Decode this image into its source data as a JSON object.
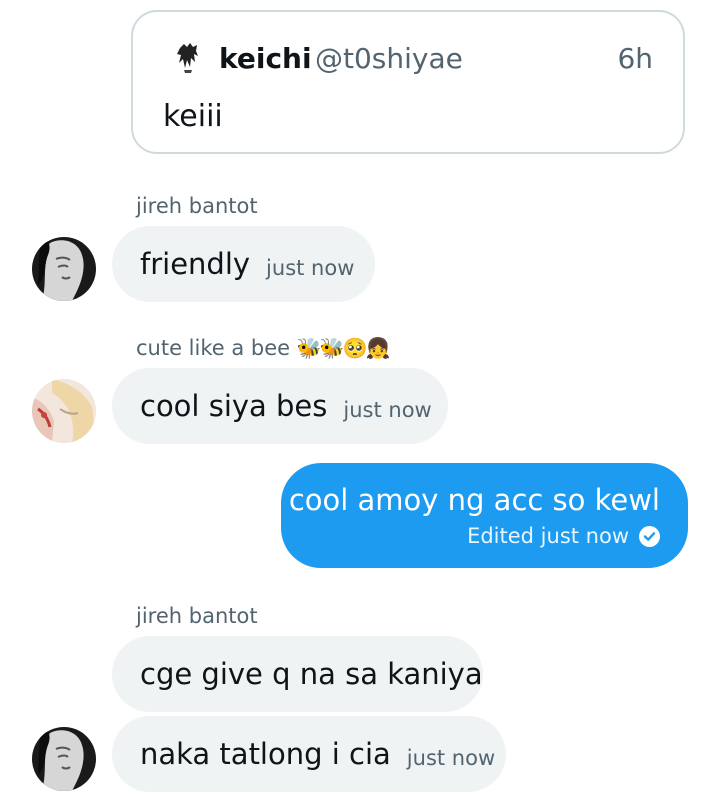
{
  "quote": {
    "name": "keichi",
    "handle": "@t0shiyae",
    "time": "6h",
    "text": "keiii"
  },
  "messages": [
    {
      "sender": "jireh bantot",
      "text": "friendly",
      "time": "just now"
    },
    {
      "sender": "cute like a bee",
      "sender_emoji": "🐝🐝🥺👧",
      "text": "cool siya bes",
      "time": "just now"
    },
    {
      "outgoing": true,
      "text": "cool amoy ng acc so kewl",
      "status": "Edited just now",
      "status_icon": "check-circle-icon"
    },
    {
      "sender": "jireh bantot",
      "text": "cge give q na sa kaniya"
    },
    {
      "text": "naka tatlong i cia",
      "time": "just now"
    }
  ],
  "colors": {
    "accent": "#1d9bf0",
    "bubble_in": "#eff3f4",
    "muted_text": "#536471",
    "card_border": "#cfd9de"
  }
}
